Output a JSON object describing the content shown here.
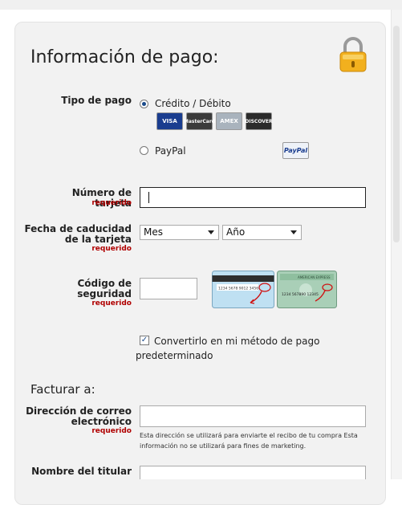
{
  "title": "Información de pago:",
  "payment_type": {
    "label": "Tipo de pago",
    "option_card": "Crédito / Débito",
    "option_paypal": "PayPal",
    "cards": [
      "VISA",
      "MasterCard",
      "AMEX",
      "DISCOVER"
    ],
    "paypal_logo": "PayPal",
    "selected": "card"
  },
  "card_number": {
    "label": "Número de tarjeta",
    "required": "requerido",
    "value": ""
  },
  "expiry": {
    "label_line1": "Fecha de caducidad",
    "label_line2": "de la tarjeta",
    "required": "requerido",
    "month": "Mes",
    "year": "Año"
  },
  "security": {
    "label_line1": "Código de",
    "label_line2": "seguridad",
    "required": "requerido",
    "value": "",
    "back_card_code": "1234 5678 9012 3456",
    "front_card_brand": "AMERICAN EXPRESS",
    "front_card_number": "1234 567890 12345"
  },
  "default_method": {
    "checked": true,
    "line1": "Convertirlo en mi método de pago",
    "line2": "predeterminado"
  },
  "billing": {
    "heading": "Facturar a:",
    "email": {
      "label_line1": "Dirección de correo",
      "label_line2": "electrónico",
      "required": "requerido",
      "value": "",
      "help": "Esta dirección se utilizará para enviarte el recibo de tu compra Esta información no se utilizará para fines de marketing."
    },
    "holder": {
      "label": "Nombre del titular"
    }
  },
  "colors": {
    "required": "#b00000",
    "panel": "#f2f2f2",
    "accent": "#1a4a8a"
  },
  "icons": {
    "lock": "padlock-icon"
  }
}
